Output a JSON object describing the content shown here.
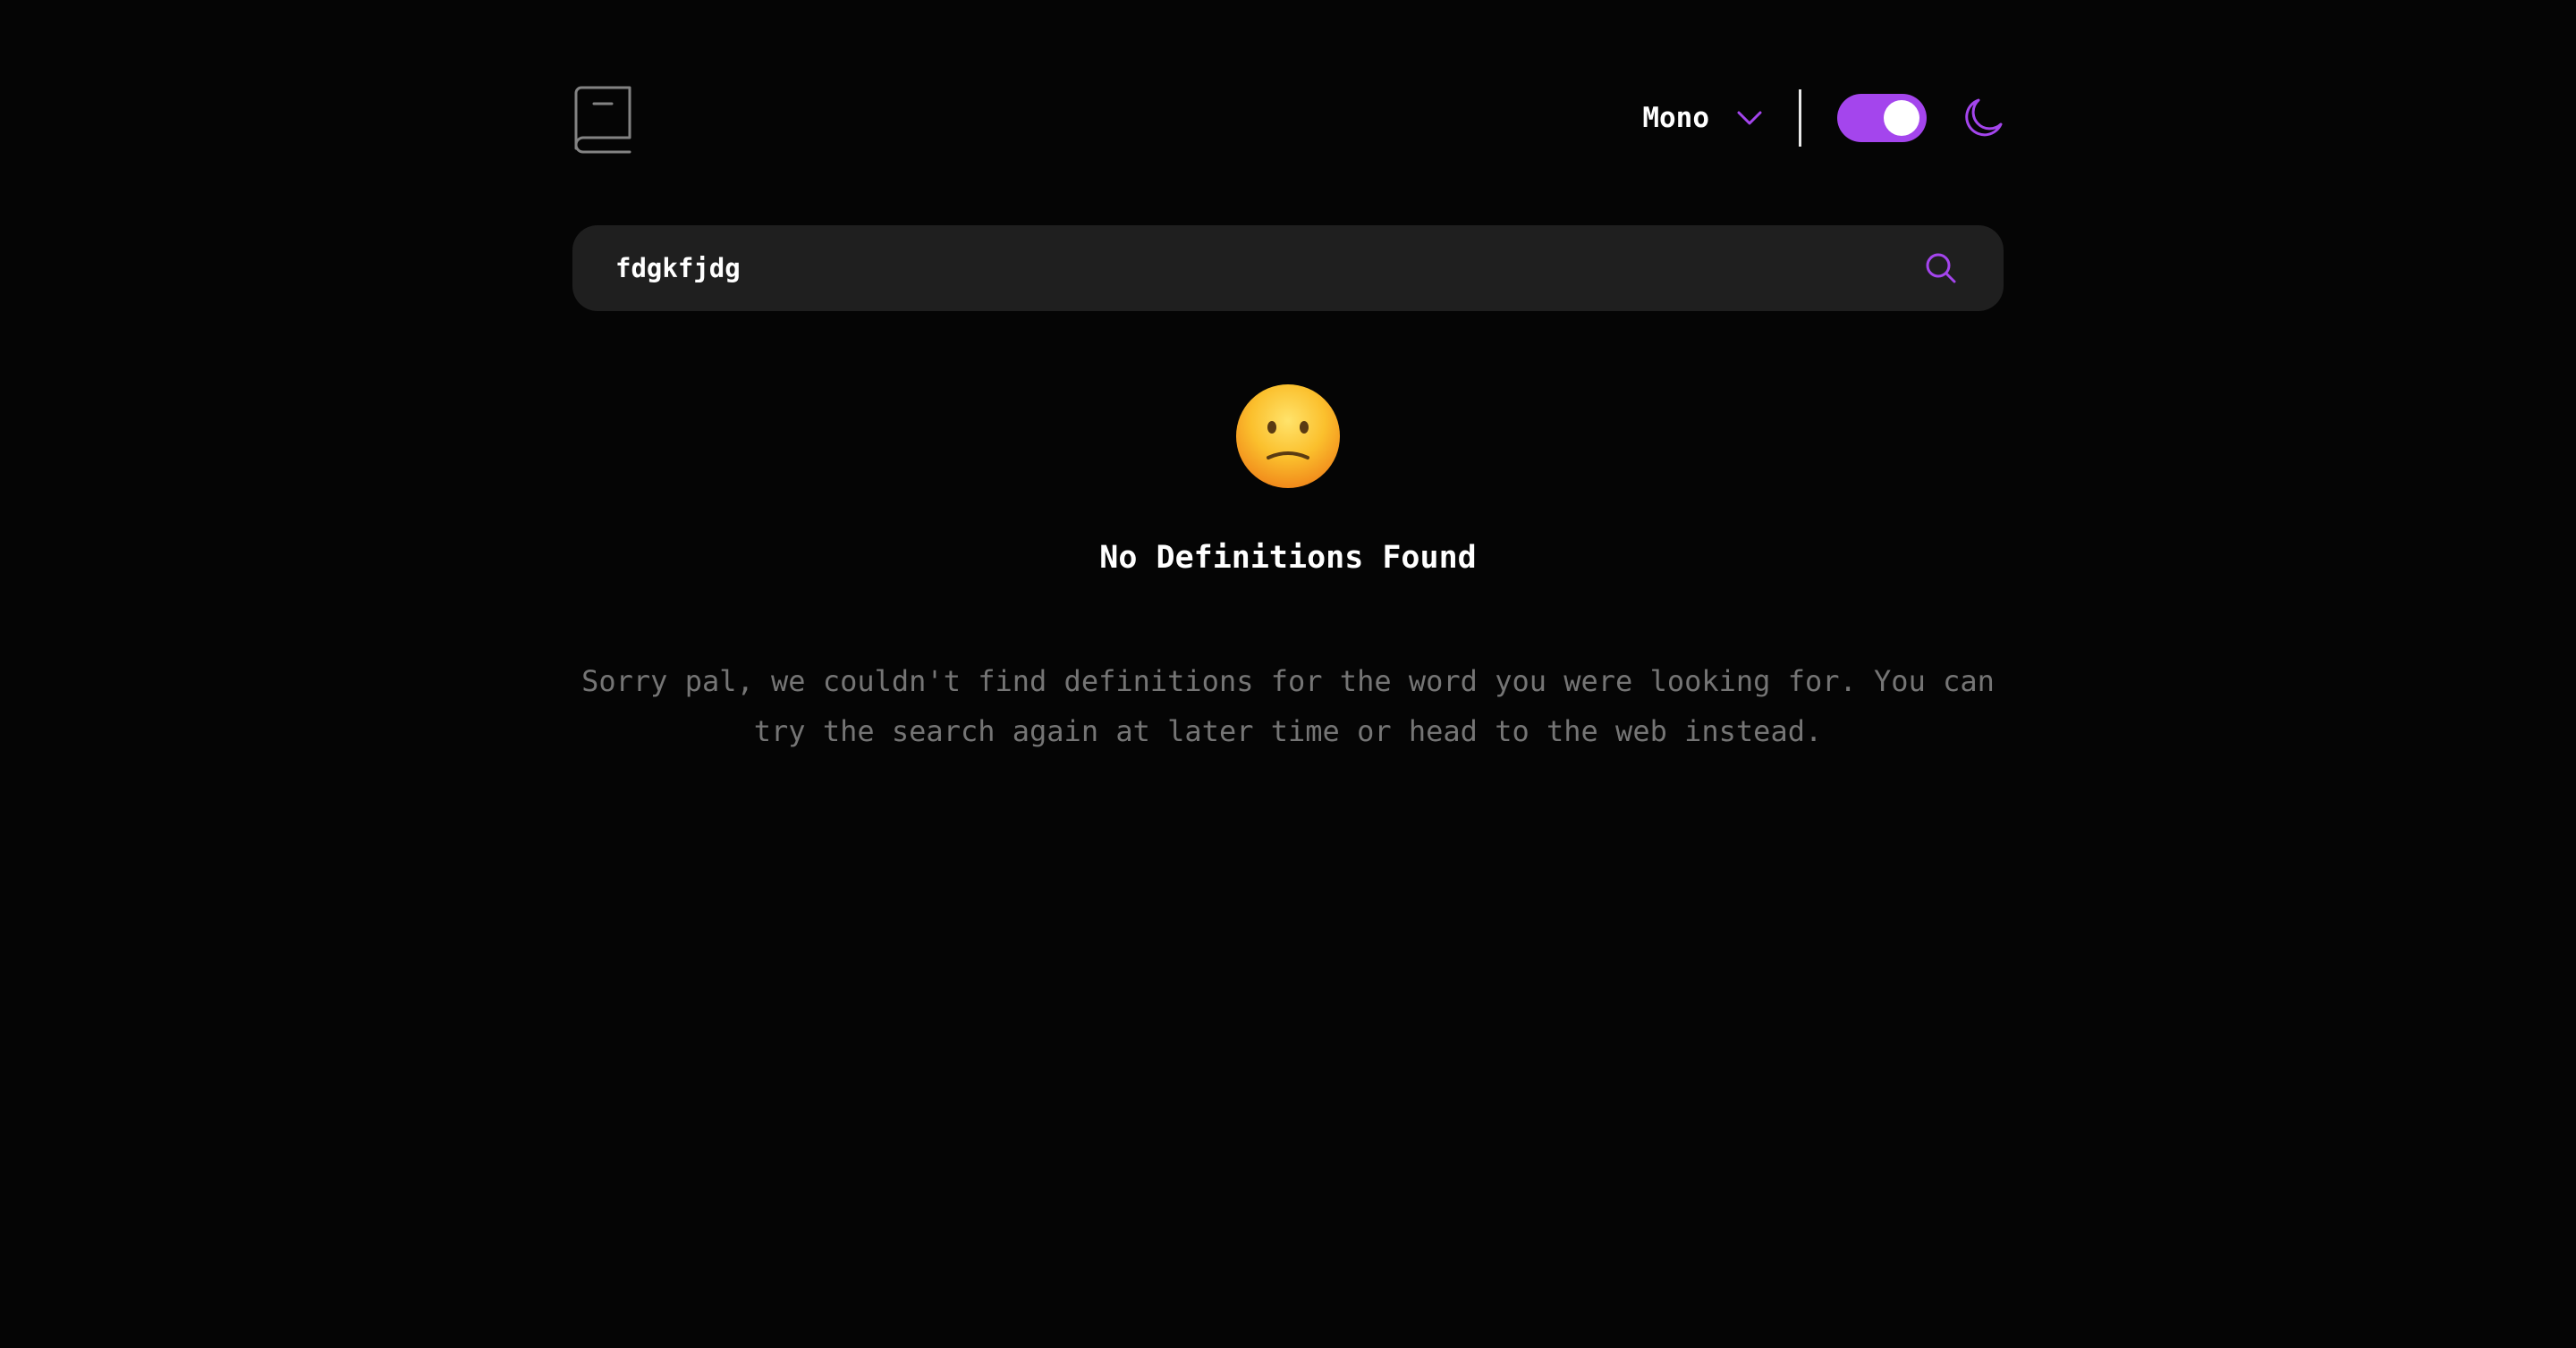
{
  "header": {
    "logo_icon": "book-icon",
    "font_selector": {
      "selected": "Mono",
      "icon": "chevron-down-icon"
    },
    "theme_toggle": {
      "state": "on",
      "icon": "moon-icon"
    }
  },
  "search": {
    "value": "fdgkfjdg",
    "icon": "search-icon"
  },
  "empty_state": {
    "emoji": "confused-face",
    "title": "No Definitions Found",
    "message": "Sorry pal, we couldn't find definitions for the word you were looking for. You can try the search again at later time or head to the web instead."
  },
  "colors": {
    "background": "#050505",
    "accent": "#a445ed",
    "search_bg": "#1f1f1f",
    "muted_text": "#757575",
    "text": "#ffffff"
  }
}
